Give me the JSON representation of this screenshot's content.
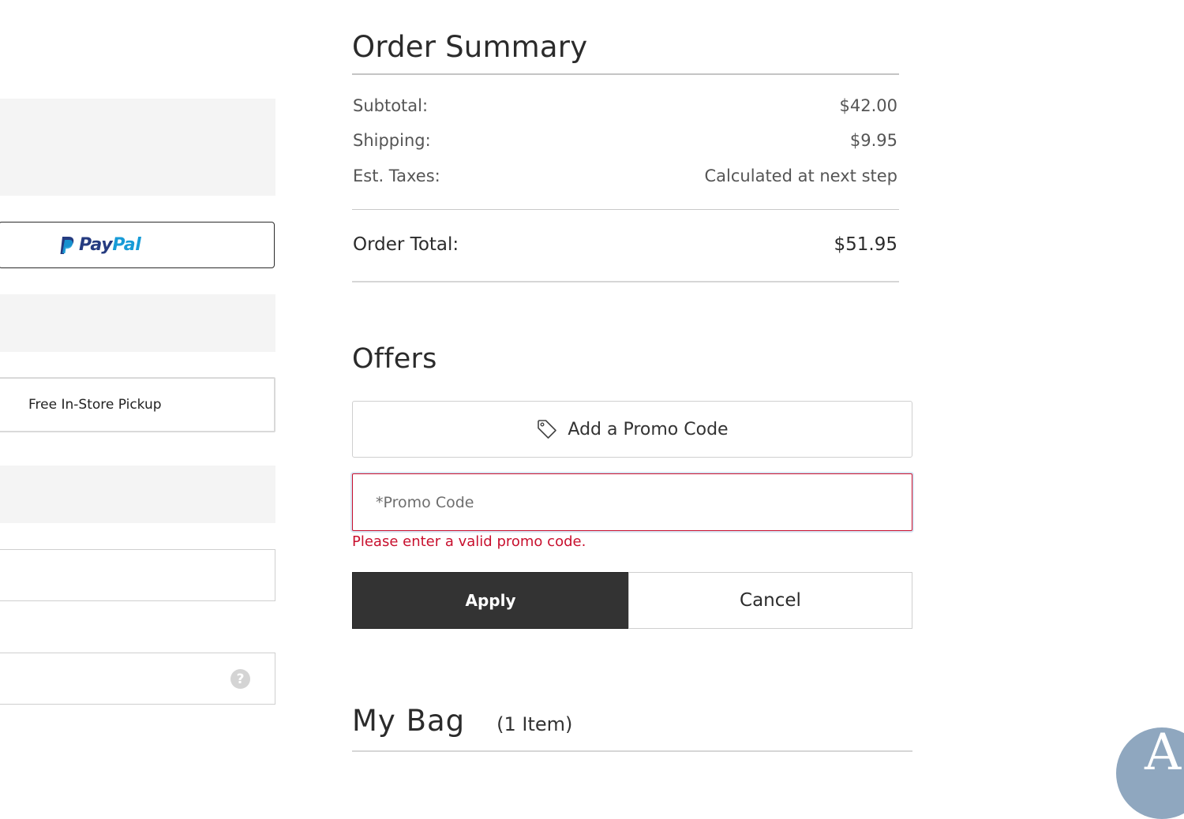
{
  "left_panel": {
    "paypal": {
      "brand_pay": "Pay",
      "brand_pal": "Pal"
    },
    "pickup_label": "Free In-Store Pickup",
    "help_symbol": "?"
  },
  "order_summary": {
    "title": "Order Summary",
    "subtotal_label": "Subtotal:",
    "subtotal_value": "$42.00",
    "shipping_label": "Shipping:",
    "shipping_value": "$9.95",
    "taxes_label": "Est. Taxes:",
    "taxes_value": "Calculated at next step",
    "total_label": "Order Total:",
    "total_value": "$51.95"
  },
  "offers": {
    "title": "Offers",
    "add_promo_label": "Add a Promo Code",
    "promo_placeholder": "*Promo Code",
    "promo_value": "",
    "error_message": "Please enter a valid promo code.",
    "apply_label": "Apply",
    "cancel_label": "Cancel"
  },
  "bag": {
    "title": "My Bag",
    "count": "(1 Item)"
  },
  "avatar": {
    "letter": "A"
  },
  "colors": {
    "error": "#c8102e",
    "apply_bg": "#333333",
    "paypal_dark": "#253b80",
    "paypal_light": "#179bd7"
  },
  "icons": {
    "tag": "tag-icon",
    "help": "help-icon",
    "paypal": "paypal-logo-icon"
  }
}
